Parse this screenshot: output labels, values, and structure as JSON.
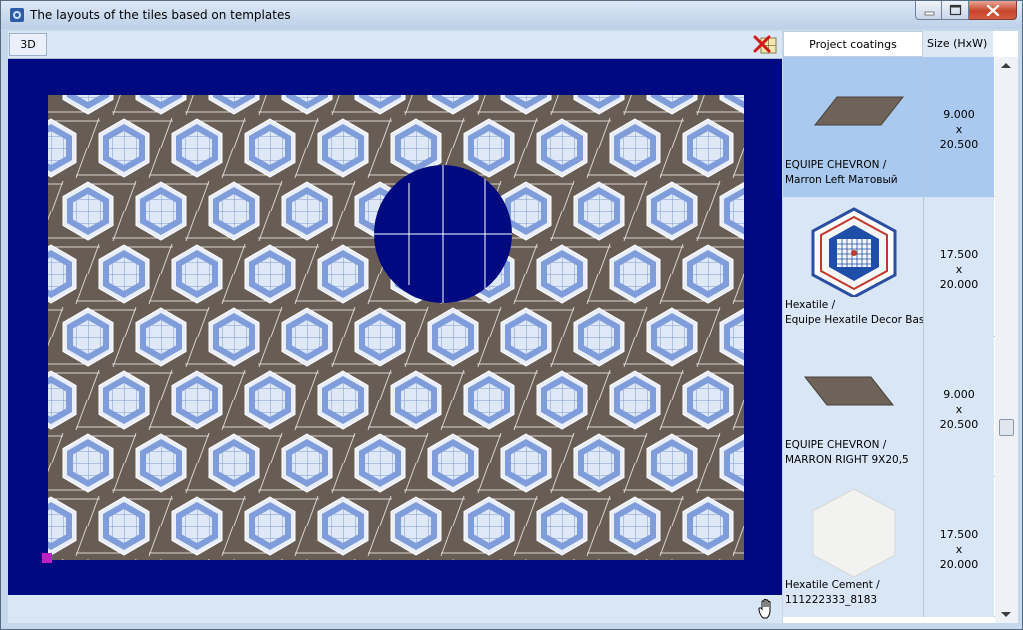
{
  "window": {
    "title": "The layouts of the tiles based on templates"
  },
  "toolbar": {
    "mode_3d_label": "3D"
  },
  "panel": {
    "header_coatings": "Project coatings",
    "header_size": "Size (HxW)",
    "items": [
      {
        "name_line1": "EQUIPE CHEVRON /",
        "name_line2": "Marron Left Матовый",
        "height": "9.000",
        "x": "x",
        "width": "20.500",
        "shape": "parallelogram-left",
        "selected": true
      },
      {
        "name_line1": "Hexatile /",
        "name_line2": "Equipe Hexatile Decor Basilic",
        "height": "17.500",
        "x": "x",
        "width": "20.000",
        "shape": "hexagon-decor",
        "selected": false
      },
      {
        "name_line1": "EQUIPE CHEVRON /",
        "name_line2": "MARRON RIGHT 9X20,5",
        "height": "9.000",
        "x": "x",
        "width": "20.500",
        "shape": "parallelogram-right",
        "selected": false
      },
      {
        "name_line1": "Hexatile Cement /",
        "name_line2": "111222333_8183",
        "height": "17.500",
        "x": "x",
        "width": "20.000",
        "shape": "hexagon-white",
        "selected": false
      }
    ]
  },
  "colors": {
    "canvas_bg": "#000a80",
    "tile_brown": "#6a5f56",
    "tile_blue": "#8aa8de",
    "selection": "#a9c9ee",
    "origin_marker": "#c020c0"
  }
}
